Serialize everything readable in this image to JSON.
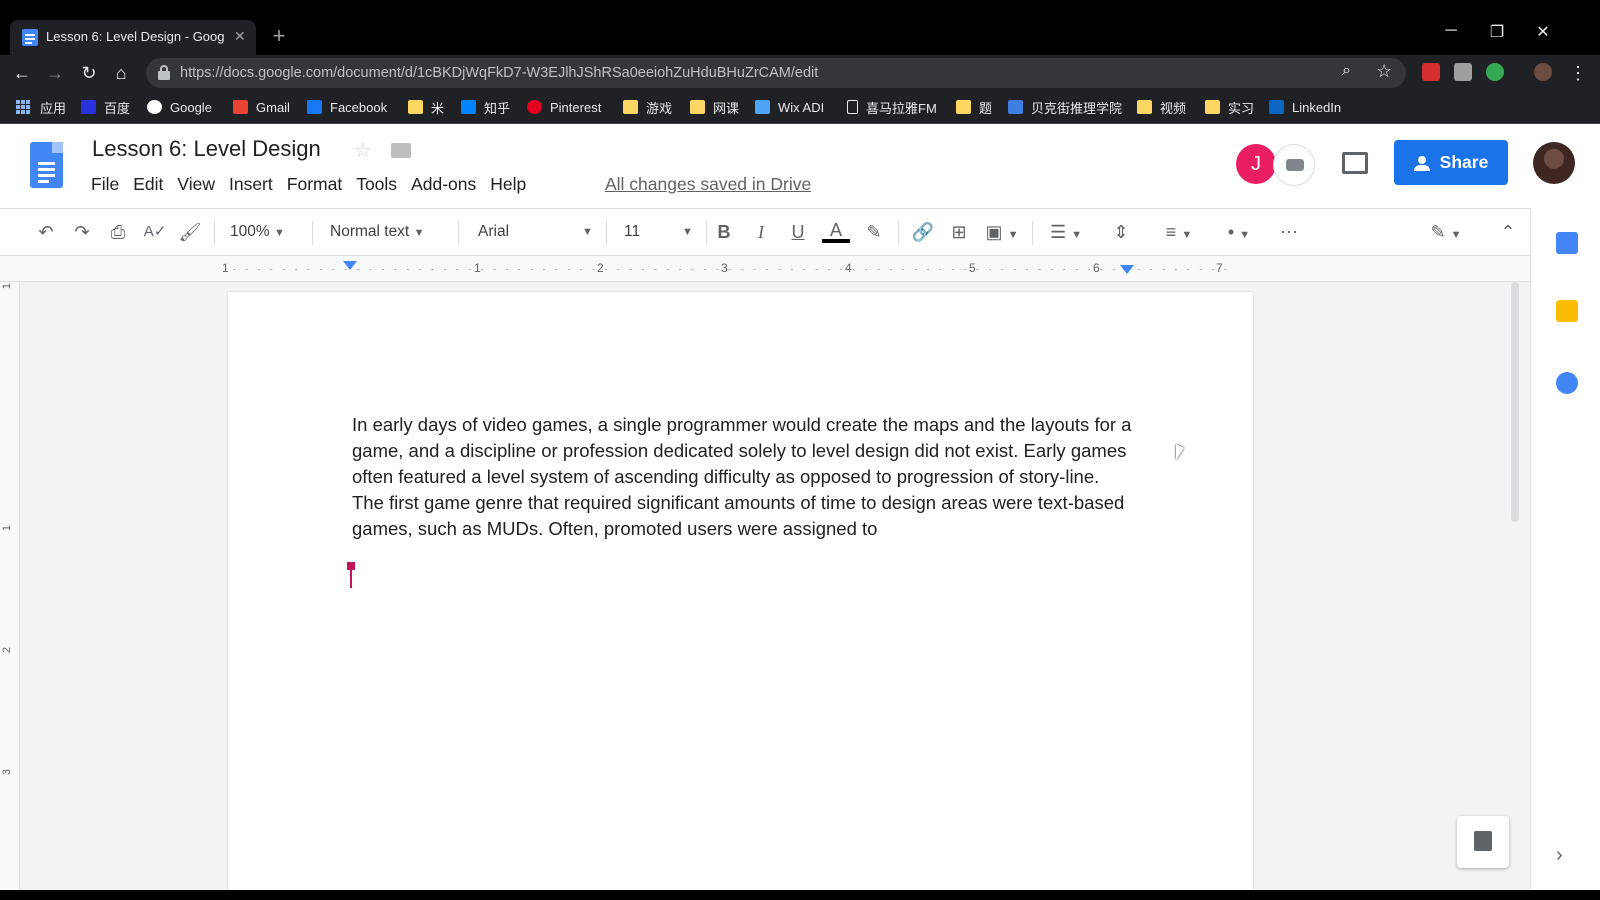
{
  "browser": {
    "tab_title": "Lesson 6: Level Design - Goog",
    "tab_close": "✕",
    "new_tab": "+",
    "url": "https://docs.google.com/document/d/1cBKDjWqFkD7-W3EJlhJShRSa0eeiohZuHduBHuZrCAM/edit",
    "window_controls": {
      "minimize": "─",
      "restore": "❐",
      "close": "✕"
    },
    "nav": {
      "back": "←",
      "forward": "→",
      "reload": "↻",
      "home": "⌂"
    },
    "omnibox_icons": {
      "zoom": "⌕",
      "star": "☆"
    }
  },
  "bookmarks": [
    {
      "label": "应用",
      "icon": "apps-grid-icon"
    },
    {
      "label": "百度",
      "icon": "baidu-icon",
      "color": "#2932e1"
    },
    {
      "label": "Google",
      "icon": "google-icon",
      "color": "#ffffff"
    },
    {
      "label": "Gmail",
      "icon": "gmail-icon",
      "color": "#ea4335"
    },
    {
      "label": "Facebook",
      "icon": "facebook-icon",
      "color": "#1877f2"
    },
    {
      "label": "米",
      "icon": "folder-icon"
    },
    {
      "label": "知乎",
      "icon": "zhihu-icon",
      "color": "#0084ff"
    },
    {
      "label": "Pinterest",
      "icon": "pinterest-icon",
      "color": "#e60023"
    },
    {
      "label": "游戏",
      "icon": "folder-icon"
    },
    {
      "label": "网课",
      "icon": "folder-icon"
    },
    {
      "label": "Wix ADI",
      "icon": "wix-icon",
      "color": "#4ea4f6"
    },
    {
      "label": "喜马拉雅FM",
      "icon": "page-icon",
      "color": "#ffffff"
    },
    {
      "label": "题",
      "icon": "folder-icon"
    },
    {
      "label": "贝克街推理学院",
      "icon": "bakerstreet-icon",
      "color": "#3f7de0"
    },
    {
      "label": "视频",
      "icon": "folder-icon"
    },
    {
      "label": "实习",
      "icon": "folder-icon"
    },
    {
      "label": "LinkedIn",
      "icon": "linkedin-icon",
      "color": "#0a66c2"
    }
  ],
  "docs": {
    "title": "Lesson 6: Level Design",
    "menu": [
      "File",
      "Edit",
      "View",
      "Insert",
      "Format",
      "Tools",
      "Add-ons",
      "Help"
    ],
    "save_status": "All changes saved in Drive",
    "collaborator_initial": "J",
    "share_label": "Share"
  },
  "toolbar": {
    "zoom": "100%",
    "style": "Normal text",
    "font": "Arial",
    "font_size": "11",
    "bold": "B",
    "italic": "I",
    "underline": "U",
    "text_color": "A",
    "more": "⋯"
  },
  "ruler": {
    "numbers": [
      "1",
      "1",
      "2",
      "3",
      "4",
      "5",
      "6",
      "7"
    ]
  },
  "vruler": {
    "numbers": [
      "1",
      "1",
      "2",
      "3"
    ]
  },
  "document": {
    "paragraphs": [
      "In early days of video games, a single programmer would create the maps and the layouts for a game, and a discipline or profession dedicated solely to level design did not exist. Early games often featured a level system of ascending difficulty as opposed to progression of story-line.",
      "The first game genre that required significant amounts of time to design areas were text-based games, such as MUDs. Often, promoted users were assigned to"
    ]
  },
  "colors": {
    "accent": "#1a73e8",
    "collaborator": "#e91e63",
    "cursor": "#c2185b"
  }
}
